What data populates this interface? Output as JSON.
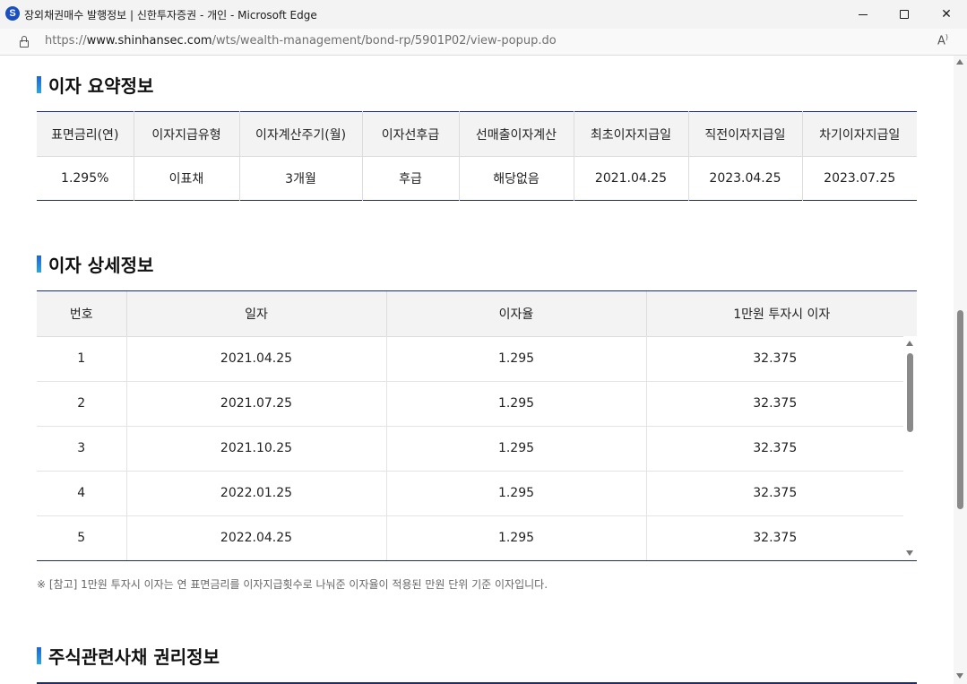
{
  "window": {
    "title": "장외채권매수 발행정보 | 신한투자증권 - 개인 - Microsoft Edge",
    "app_icon_letter": "S",
    "icons": [
      "minimize-icon",
      "maximize-icon",
      "close-icon"
    ]
  },
  "address": {
    "prefix": "https://",
    "host": "www.shinhansec.com",
    "path": "/wts/wealth-management/bond-rp/5901P02/view-popup.do",
    "read_aloud": "Aͅ"
  },
  "summary": {
    "title": "이자 요약정보",
    "headers": [
      "표면금리(연)",
      "이자지급유형",
      "이자계산주기(월)",
      "이자선후급",
      "선매출이자계산",
      "최초이자지급일",
      "직전이자지급일",
      "차기이자지급일"
    ],
    "values": [
      "1.295%",
      "이표채",
      "3개월",
      "후급",
      "해당없음",
      "2021.04.25",
      "2023.04.25",
      "2023.07.25"
    ]
  },
  "detail": {
    "title": "이자 상세정보",
    "headers": [
      "번호",
      "일자",
      "이자율",
      "1만원 투자시 이자"
    ],
    "rows": [
      [
        "1",
        "2021.04.25",
        "1.295",
        "32.375"
      ],
      [
        "2",
        "2021.07.25",
        "1.295",
        "32.375"
      ],
      [
        "3",
        "2021.10.25",
        "1.295",
        "32.375"
      ],
      [
        "4",
        "2022.01.25",
        "1.295",
        "32.375"
      ],
      [
        "5",
        "2022.04.25",
        "1.295",
        "32.375"
      ]
    ],
    "note": "※ [참고] 1만원 투자시 이자는 연 표면금리를 이자지급횟수로 나눠준 이자율이 적용된 만원 단위 기준 이자입니다."
  },
  "rights": {
    "title": "주식관련사채 권리정보"
  },
  "colors": {
    "accent_bar": "#1e63d8",
    "table_border": "#1e2c6a",
    "header_bg": "#f3f3f3"
  }
}
